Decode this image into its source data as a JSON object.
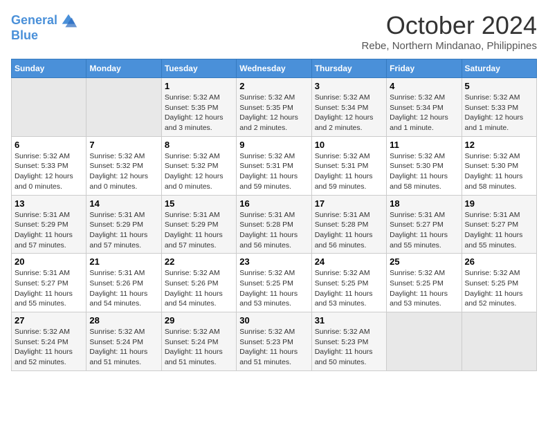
{
  "header": {
    "logo_line1": "General",
    "logo_line2": "Blue",
    "month_title": "October 2024",
    "subtitle": "Rebe, Northern Mindanao, Philippines"
  },
  "days_of_week": [
    "Sunday",
    "Monday",
    "Tuesday",
    "Wednesday",
    "Thursday",
    "Friday",
    "Saturday"
  ],
  "weeks": [
    [
      {
        "day": "",
        "info": ""
      },
      {
        "day": "",
        "info": ""
      },
      {
        "day": "1",
        "info": "Sunrise: 5:32 AM\nSunset: 5:35 PM\nDaylight: 12 hours and 3 minutes."
      },
      {
        "day": "2",
        "info": "Sunrise: 5:32 AM\nSunset: 5:35 PM\nDaylight: 12 hours and 2 minutes."
      },
      {
        "day": "3",
        "info": "Sunrise: 5:32 AM\nSunset: 5:34 PM\nDaylight: 12 hours and 2 minutes."
      },
      {
        "day": "4",
        "info": "Sunrise: 5:32 AM\nSunset: 5:34 PM\nDaylight: 12 hours and 1 minute."
      },
      {
        "day": "5",
        "info": "Sunrise: 5:32 AM\nSunset: 5:33 PM\nDaylight: 12 hours and 1 minute."
      }
    ],
    [
      {
        "day": "6",
        "info": "Sunrise: 5:32 AM\nSunset: 5:33 PM\nDaylight: 12 hours and 0 minutes."
      },
      {
        "day": "7",
        "info": "Sunrise: 5:32 AM\nSunset: 5:32 PM\nDaylight: 12 hours and 0 minutes."
      },
      {
        "day": "8",
        "info": "Sunrise: 5:32 AM\nSunset: 5:32 PM\nDaylight: 12 hours and 0 minutes."
      },
      {
        "day": "9",
        "info": "Sunrise: 5:32 AM\nSunset: 5:31 PM\nDaylight: 11 hours and 59 minutes."
      },
      {
        "day": "10",
        "info": "Sunrise: 5:32 AM\nSunset: 5:31 PM\nDaylight: 11 hours and 59 minutes."
      },
      {
        "day": "11",
        "info": "Sunrise: 5:32 AM\nSunset: 5:30 PM\nDaylight: 11 hours and 58 minutes."
      },
      {
        "day": "12",
        "info": "Sunrise: 5:32 AM\nSunset: 5:30 PM\nDaylight: 11 hours and 58 minutes."
      }
    ],
    [
      {
        "day": "13",
        "info": "Sunrise: 5:31 AM\nSunset: 5:29 PM\nDaylight: 11 hours and 57 minutes."
      },
      {
        "day": "14",
        "info": "Sunrise: 5:31 AM\nSunset: 5:29 PM\nDaylight: 11 hours and 57 minutes."
      },
      {
        "day": "15",
        "info": "Sunrise: 5:31 AM\nSunset: 5:29 PM\nDaylight: 11 hours and 57 minutes."
      },
      {
        "day": "16",
        "info": "Sunrise: 5:31 AM\nSunset: 5:28 PM\nDaylight: 11 hours and 56 minutes."
      },
      {
        "day": "17",
        "info": "Sunrise: 5:31 AM\nSunset: 5:28 PM\nDaylight: 11 hours and 56 minutes."
      },
      {
        "day": "18",
        "info": "Sunrise: 5:31 AM\nSunset: 5:27 PM\nDaylight: 11 hours and 55 minutes."
      },
      {
        "day": "19",
        "info": "Sunrise: 5:31 AM\nSunset: 5:27 PM\nDaylight: 11 hours and 55 minutes."
      }
    ],
    [
      {
        "day": "20",
        "info": "Sunrise: 5:31 AM\nSunset: 5:27 PM\nDaylight: 11 hours and 55 minutes."
      },
      {
        "day": "21",
        "info": "Sunrise: 5:31 AM\nSunset: 5:26 PM\nDaylight: 11 hours and 54 minutes."
      },
      {
        "day": "22",
        "info": "Sunrise: 5:32 AM\nSunset: 5:26 PM\nDaylight: 11 hours and 54 minutes."
      },
      {
        "day": "23",
        "info": "Sunrise: 5:32 AM\nSunset: 5:25 PM\nDaylight: 11 hours and 53 minutes."
      },
      {
        "day": "24",
        "info": "Sunrise: 5:32 AM\nSunset: 5:25 PM\nDaylight: 11 hours and 53 minutes."
      },
      {
        "day": "25",
        "info": "Sunrise: 5:32 AM\nSunset: 5:25 PM\nDaylight: 11 hours and 53 minutes."
      },
      {
        "day": "26",
        "info": "Sunrise: 5:32 AM\nSunset: 5:25 PM\nDaylight: 11 hours and 52 minutes."
      }
    ],
    [
      {
        "day": "27",
        "info": "Sunrise: 5:32 AM\nSunset: 5:24 PM\nDaylight: 11 hours and 52 minutes."
      },
      {
        "day": "28",
        "info": "Sunrise: 5:32 AM\nSunset: 5:24 PM\nDaylight: 11 hours and 51 minutes."
      },
      {
        "day": "29",
        "info": "Sunrise: 5:32 AM\nSunset: 5:24 PM\nDaylight: 11 hours and 51 minutes."
      },
      {
        "day": "30",
        "info": "Sunrise: 5:32 AM\nSunset: 5:23 PM\nDaylight: 11 hours and 51 minutes."
      },
      {
        "day": "31",
        "info": "Sunrise: 5:32 AM\nSunset: 5:23 PM\nDaylight: 11 hours and 50 minutes."
      },
      {
        "day": "",
        "info": ""
      },
      {
        "day": "",
        "info": ""
      }
    ]
  ]
}
